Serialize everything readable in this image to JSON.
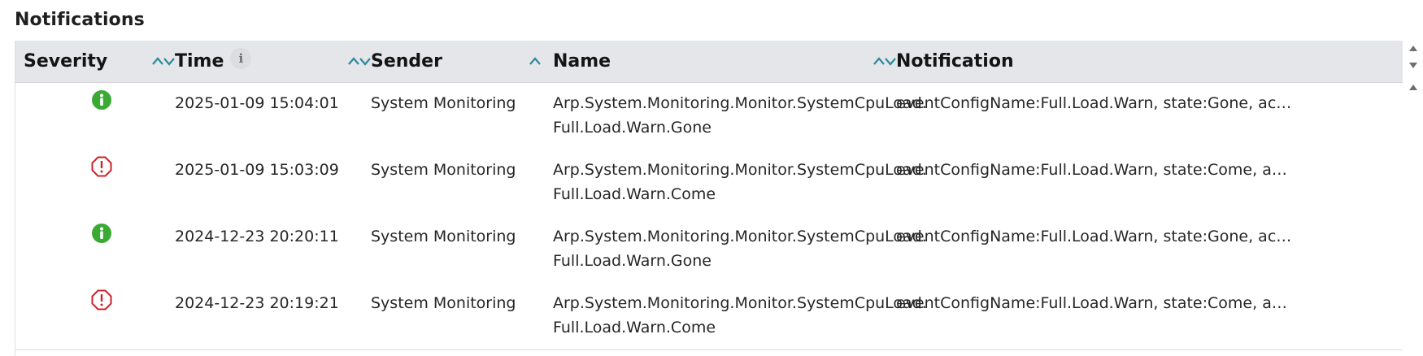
{
  "page": {
    "title": "Notifications"
  },
  "columns": [
    {
      "label": "Severity",
      "sort_icon": "sort-both-icon"
    },
    {
      "label": "Time",
      "sort_icon": "sort-both-icon",
      "info_icon": "info-icon"
    },
    {
      "label": "Sender",
      "sort_icon": "sort-ascending-icon"
    },
    {
      "label": "Name",
      "sort_icon": "sort-both-icon"
    },
    {
      "label": "Notification"
    }
  ],
  "info_badge_glyph": "i",
  "rows": [
    {
      "severity": "info",
      "time": "2025-01-09 15:04:01",
      "sender": "System Monitoring",
      "name": "Arp.System.Monitoring.Monitor.SystemCpuLoad.Full.Load.Warn.Gone",
      "notification": "eventConfigName:Full.Load.Warn, state:Gone, actua..."
    },
    {
      "severity": "error",
      "time": "2025-01-09 15:03:09",
      "sender": "System Monitoring",
      "name": "Arp.System.Monitoring.Monitor.SystemCpuLoad.Full.Load.Warn.Come",
      "notification": "eventConfigName:Full.Load.Warn, state:Come, actu..."
    },
    {
      "severity": "info",
      "time": "2024-12-23 20:20:11",
      "sender": "System Monitoring",
      "name": "Arp.System.Monitoring.Monitor.SystemCpuLoad.Full.Load.Warn.Gone",
      "notification": "eventConfigName:Full.Load.Warn, state:Gone, actua..."
    },
    {
      "severity": "error",
      "time": "2024-12-23 20:19:21",
      "sender": "System Monitoring",
      "name": "Arp.System.Monitoring.Monitor.SystemCpuLoad.Full.Load.Warn.Come",
      "notification": "eventConfigName:Full.Load.Warn, state:Come, actu..."
    }
  ],
  "colors": {
    "info": "#3aaa35",
    "error": "#d0202a",
    "sort_accent": "#2b8a9a",
    "header_bg": "#e4e6ea"
  }
}
